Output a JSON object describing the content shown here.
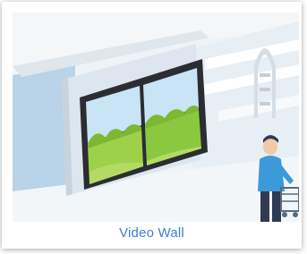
{
  "card": {
    "caption": "Video Wall",
    "caption_color": "#3a7fd0"
  },
  "illustration": {
    "subject": "video-wall",
    "icons": [
      "video-wall-screen-icon",
      "security-gate-icon",
      "shopper-with-cart-icon"
    ],
    "colors": {
      "wall": "#b9d3e8",
      "ceiling": "#e9eef3",
      "panel": "#dde6ee",
      "screen_frame": "#2b2d33",
      "sky": "#c8e4f5",
      "grass": "#8cc83f",
      "person_shirt": "#3d9ad8"
    }
  }
}
